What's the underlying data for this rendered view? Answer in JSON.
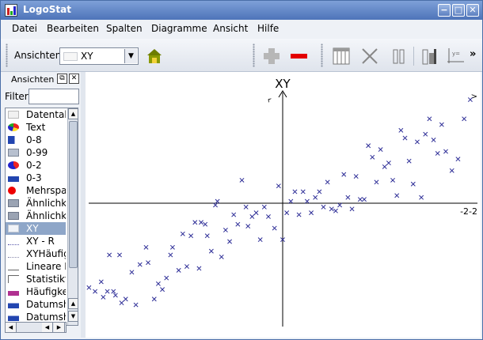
{
  "window": {
    "title": "LogoStat",
    "buttons": {
      "minimize": "−",
      "maximize": "□",
      "close": "✕"
    }
  },
  "menu": [
    "Datei",
    "Bearbeiten",
    "Spalten",
    "Diagramme",
    "Ansicht",
    "Hilfe"
  ],
  "toolbar": {
    "views_label": "Ansichten",
    "view_select": {
      "value": "XY"
    },
    "overflow": "»",
    "icons": [
      "house-icon",
      "add-icon",
      "remove-icon",
      "table-columns-icon",
      "delete-cross-icon",
      "column-icon",
      "chart-icon",
      "formula-axes-icon"
    ],
    "colors": {
      "add": "#b7b7b7",
      "remove": "#e30000",
      "house": "#6d7d00"
    }
  },
  "sidebar": {
    "title": "Ansichten",
    "filter_label": "Filter",
    "filter_value": "",
    "items": [
      {
        "label": "Datentab",
        "icon": "table-icon"
      },
      {
        "label": "Text",
        "icon": "text-pie-icon"
      },
      {
        "label": "0-8",
        "icon": "bar-h-icon"
      },
      {
        "label": "0-99",
        "icon": "image-grid-icon"
      },
      {
        "label": "0-2",
        "icon": "pie-icon"
      },
      {
        "label": "0-3",
        "icon": "bar-v-icon"
      },
      {
        "label": "Mehrspa",
        "icon": "red-dot-icon"
      },
      {
        "label": "Ähnlichk",
        "icon": "similarity-icon"
      },
      {
        "label": "Ähnlichk",
        "icon": "similarity-icon"
      },
      {
        "label": "XY",
        "icon": "xy-icon",
        "selected": true
      },
      {
        "label": "XY - R",
        "icon": "xy-regression-icon"
      },
      {
        "label": "XYHäufig",
        "icon": "xy-frequency-icon"
      },
      {
        "label": "Lineare F",
        "icon": "linear-icon"
      },
      {
        "label": "Statistikta",
        "icon": "stats-table-icon"
      },
      {
        "label": "Häufigke",
        "icon": "histogram-icon"
      },
      {
        "label": "Datumsh",
        "icon": "date-bar-icon"
      },
      {
        "label": "Datumsh",
        "icon": "date-bar-icon"
      }
    ]
  },
  "chart_data": {
    "type": "scatter",
    "title": "XY",
    "xlabel": "",
    "ylabel": "",
    "y_axis_label_partial": "^",
    "x_tick_right": "-2-2",
    "top_right_tick": ">",
    "marker": "x",
    "marker_color": "#2c2c96",
    "xlim": [
      -4.85,
      4.85
    ],
    "ylim": [
      -3.0,
      3.0
    ],
    "series": [
      {
        "x": [
          -4.75,
          -4.6,
          -4.45,
          -4.4,
          -4.3,
          -4.25,
          -4.15,
          -4.1,
          -4.0,
          -3.95,
          -3.85,
          -3.7,
          -3.6,
          -3.5,
          -3.35,
          -3.3,
          -3.15,
          -3.05,
          -2.95,
          -2.85,
          -2.75,
          -2.7,
          -2.55,
          -2.45,
          -2.35,
          -2.25,
          -2.15,
          -2.05,
          -2.0,
          -1.9,
          -1.85,
          -1.75,
          -1.65,
          -1.6,
          -1.5,
          -1.4,
          -1.3,
          -1.2,
          -1.1,
          -1.0,
          -0.9,
          -0.85,
          -0.75,
          -0.65,
          -0.55,
          -0.45,
          -0.35,
          -0.2,
          -0.1,
          0.0,
          0.1,
          0.2,
          0.3,
          0.4,
          0.5,
          0.6,
          0.7,
          0.8,
          0.9,
          1.0,
          1.1,
          1.2,
          1.3,
          1.4,
          1.5,
          1.6,
          1.7,
          1.8,
          1.9,
          2.0,
          2.1,
          2.2,
          2.3,
          2.4,
          2.5,
          2.6,
          2.7,
          2.8,
          2.9,
          3.0,
          3.1,
          3.2,
          3.3,
          3.4,
          3.5,
          3.6,
          3.7,
          3.8,
          3.9,
          4.0,
          4.15,
          4.3,
          4.45,
          4.6
        ],
        "y": [
          -2.2,
          -2.3,
          -2.05,
          -2.45,
          -2.3,
          -1.35,
          -2.3,
          -2.4,
          -1.35,
          -2.6,
          -2.5,
          -1.8,
          -2.65,
          -1.6,
          -1.15,
          -1.55,
          -2.5,
          -2.1,
          -2.25,
          -1.95,
          -1.35,
          -1.15,
          -1.75,
          -0.8,
          -1.65,
          -0.85,
          -0.5,
          -1.7,
          -0.5,
          -0.55,
          -0.85,
          -1.25,
          -0.05,
          0.05,
          -1.4,
          -0.7,
          -1.0,
          -0.3,
          -0.55,
          0.6,
          -0.1,
          -0.6,
          -0.35,
          -0.25,
          -0.95,
          -0.1,
          -0.35,
          -0.65,
          0.45,
          -0.95,
          -0.25,
          0.05,
          0.3,
          -0.3,
          0.3,
          0.05,
          -0.25,
          0.15,
          0.3,
          -0.1,
          0.55,
          -0.15,
          -0.2,
          -0.05,
          0.75,
          0.15,
          -0.15,
          0.7,
          0.1,
          0.1,
          1.5,
          1.2,
          0.55,
          1.4,
          0.95,
          1.05,
          0.6,
          0.2,
          1.9,
          1.7,
          1.1,
          0.5,
          1.6,
          0.15,
          1.8,
          2.2,
          1.65,
          1.3,
          2.05,
          1.35,
          0.85,
          1.15,
          2.2,
          2.7
        ]
      }
    ]
  }
}
